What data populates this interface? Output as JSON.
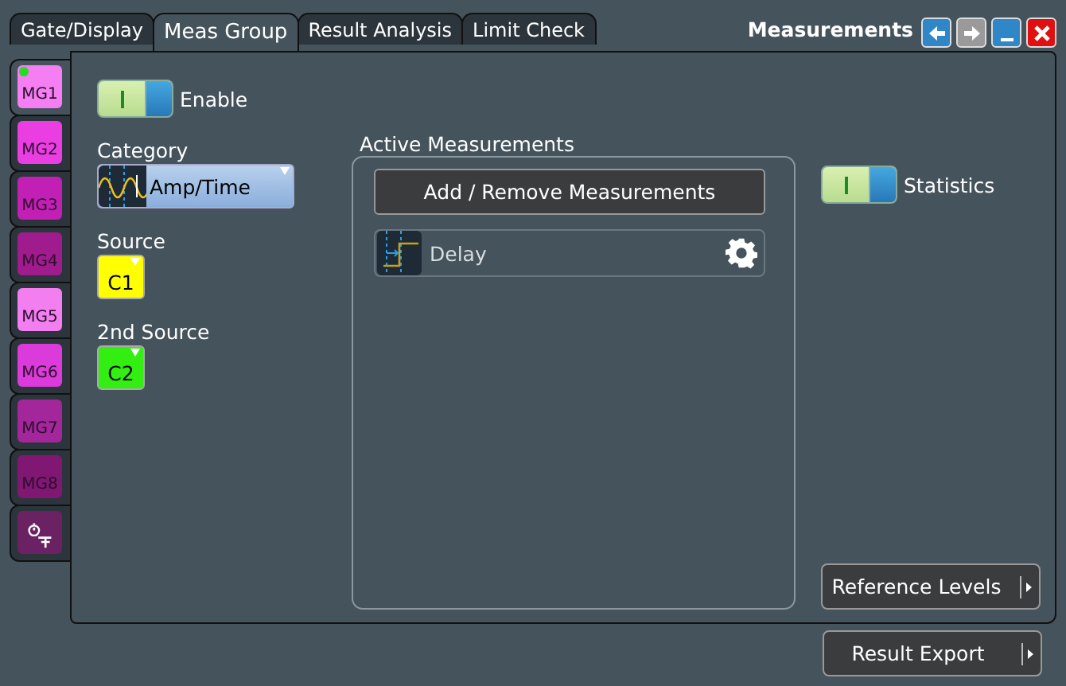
{
  "tabs": [
    {
      "label": "Gate/Display",
      "selected": false
    },
    {
      "label": "Meas Group",
      "selected": true
    },
    {
      "label": "Result Analysis",
      "selected": false
    },
    {
      "label": "Limit Check",
      "selected": false
    }
  ],
  "header": {
    "title": "Measurements"
  },
  "window_buttons": [
    {
      "kind": "back",
      "disabled": false
    },
    {
      "kind": "forward",
      "disabled": true
    },
    {
      "kind": "minimize",
      "disabled": false
    },
    {
      "kind": "close",
      "disabled": false
    }
  ],
  "group_tabs": [
    {
      "kind": "group",
      "label": "MG1",
      "color": "#f47ef2",
      "selected": true,
      "active": true
    },
    {
      "kind": "group",
      "label": "MG2",
      "color": "#ea3de2",
      "selected": false,
      "active": false
    },
    {
      "kind": "group",
      "label": "MG3",
      "color": "#c21fb4",
      "selected": false,
      "active": false
    },
    {
      "kind": "group",
      "label": "MG4",
      "color": "#a01b8e",
      "selected": false,
      "active": false
    },
    {
      "kind": "group",
      "label": "MG5",
      "color": "#f27ef0",
      "selected": false,
      "active": false
    },
    {
      "kind": "group",
      "label": "MG6",
      "color": "#db3bda",
      "selected": false,
      "active": false
    },
    {
      "kind": "group",
      "label": "MG7",
      "color": "#a3269a",
      "selected": false,
      "active": false
    },
    {
      "kind": "group",
      "label": "MG8",
      "color": "#801772",
      "selected": false,
      "active": false
    },
    {
      "kind": "timer",
      "color": "#6b2262",
      "selected": false,
      "active": false
    }
  ],
  "enable": {
    "label": "Enable",
    "on": true
  },
  "category": {
    "label": "Category",
    "value": "Amp/Time"
  },
  "source": {
    "label": "Source",
    "value": "C1",
    "color": "#ffff00"
  },
  "second_source": {
    "label": "2nd Source",
    "value": "C2",
    "color": "#33ee11"
  },
  "active_measurements": {
    "title": "Active Measurements",
    "add_button": "Add / Remove Measurements",
    "items": [
      {
        "label": "Delay"
      }
    ]
  },
  "statistics": {
    "label": "Statistics",
    "on": true
  },
  "buttons": [
    "Reference Levels",
    "Result Export"
  ]
}
